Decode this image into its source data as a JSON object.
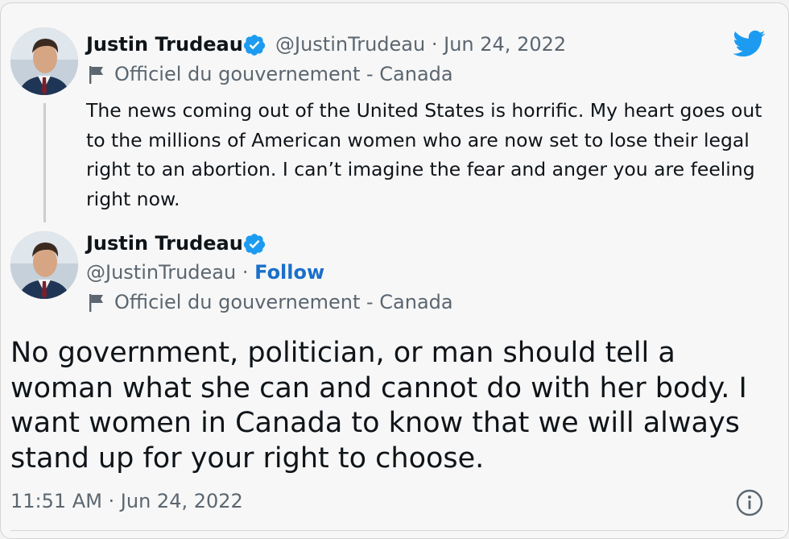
{
  "quoted_tweet": {
    "author_name": "Justin Trudeau",
    "handle": "@JustinTrudeau",
    "separator": "·",
    "date": "Jun 24, 2022",
    "label": "Officiel du gouvernement - Canada",
    "text": "The news coming out of the United States is horrific. My heart goes out to the millions of American women who are now set to lose their legal right to an abortion. I can’t imagine the fear and anger you are feeling right now."
  },
  "tweet": {
    "author_name": "Justin Trudeau",
    "handle": "@JustinTrudeau",
    "separator": "·",
    "follow_label": "Follow",
    "label": "Officiel du gouvernement - Canada",
    "text": "No government, politician, or man should tell a woman what she can and cannot do with her body. I want women in Canada to know that we will always stand up for your right to choose.",
    "timestamp": "11:51 AM · Jun 24, 2022"
  },
  "icons": {
    "brand": "twitter-bird-icon",
    "verified": "verified-badge-icon",
    "label": "flag-icon",
    "info": "info-icon"
  },
  "colors": {
    "verified": "#1d9bf0",
    "twitter_blue": "#1d9bf0",
    "follow_link": "#1a6fc9",
    "secondary_text": "#5b6670"
  }
}
